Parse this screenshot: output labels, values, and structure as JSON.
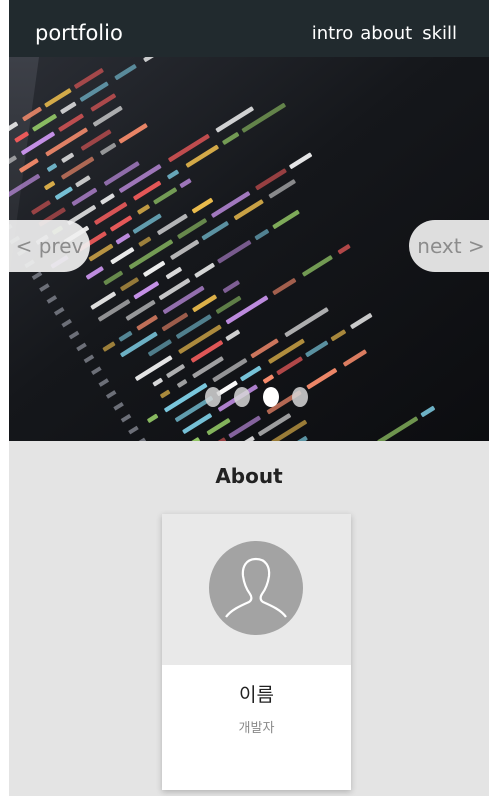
{
  "header": {
    "logo": "portfolio",
    "nav": [
      "intro",
      "about",
      "skill"
    ]
  },
  "slider": {
    "prev_label": "< prev",
    "next_label": "next >",
    "slide_count": 4,
    "active_index": 2,
    "image": "code-editor-screen"
  },
  "about": {
    "title": "About",
    "card": {
      "name": "이름",
      "role": "개발자",
      "avatar_icon": "person-silhouette-icon"
    }
  }
}
